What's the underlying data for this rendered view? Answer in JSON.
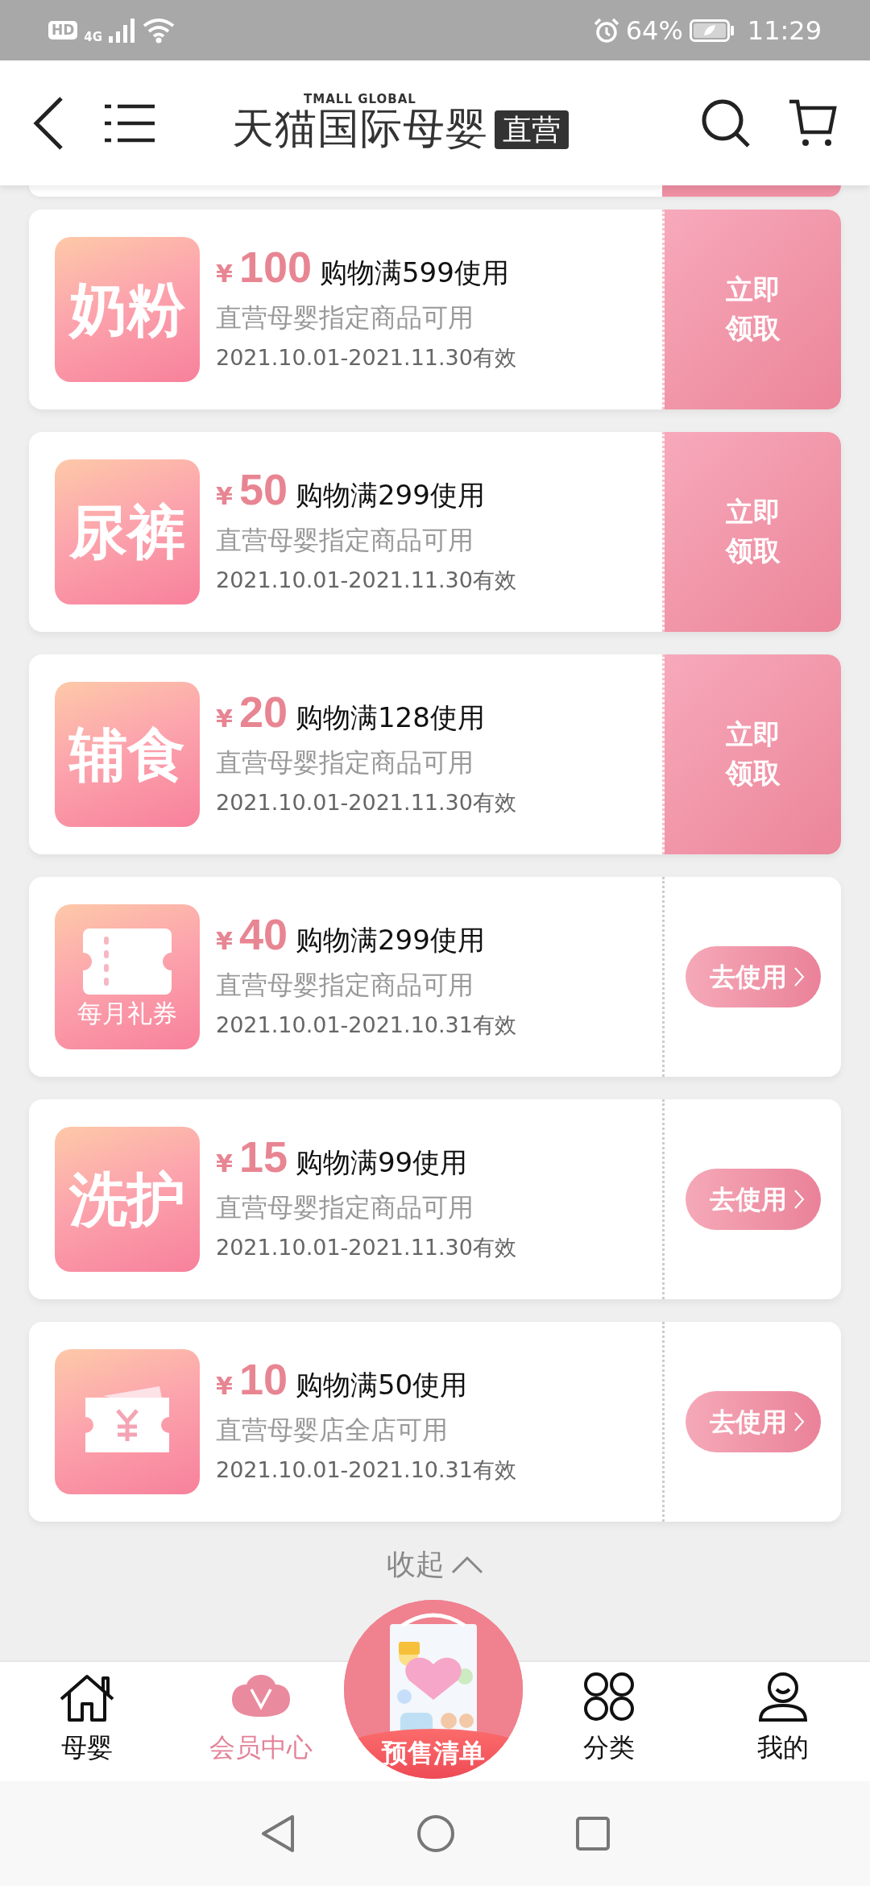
{
  "status_bar": {
    "hd": "HD",
    "network": "4G",
    "battery": "64%",
    "time": "11:29"
  },
  "header": {
    "brand_small": "TMALL GLOBAL",
    "brand": "天猫国际母婴",
    "badge": "直营"
  },
  "coupons": [
    {
      "icon": {
        "kind": "text",
        "label": "奶粉"
      },
      "currency": "¥",
      "amount": "100",
      "condition": "购物满599使用",
      "scope": "直营母婴指定商品可用",
      "validity": "2021.10.01-2021.11.30有效",
      "action": {
        "kind": "claim",
        "label": "立即领取"
      }
    },
    {
      "icon": {
        "kind": "text",
        "label": "尿裤"
      },
      "currency": "¥",
      "amount": "50",
      "condition": "购物满299使用",
      "scope": "直营母婴指定商品可用",
      "validity": "2021.10.01-2021.11.30有效",
      "action": {
        "kind": "claim",
        "label": "立即领取"
      }
    },
    {
      "icon": {
        "kind": "text",
        "label": "辅食"
      },
      "currency": "¥",
      "amount": "20",
      "condition": "购物满128使用",
      "scope": "直营母婴指定商品可用",
      "validity": "2021.10.01-2021.11.30有效",
      "action": {
        "kind": "claim",
        "label": "立即领取"
      }
    },
    {
      "icon": {
        "kind": "ticket",
        "label": "每月礼券"
      },
      "currency": "¥",
      "amount": "40",
      "condition": "购物满299使用",
      "scope": "直营母婴指定商品可用",
      "validity": "2021.10.01-2021.10.31有效",
      "action": {
        "kind": "use",
        "label": "去使用"
      }
    },
    {
      "icon": {
        "kind": "text",
        "label": "洗护"
      },
      "currency": "¥",
      "amount": "15",
      "condition": "购物满99使用",
      "scope": "直营母婴指定商品可用",
      "validity": "2021.10.01-2021.11.30有效",
      "action": {
        "kind": "use",
        "label": "去使用"
      }
    },
    {
      "icon": {
        "kind": "yen"
      },
      "currency": "¥",
      "amount": "10",
      "condition": "购物满50使用",
      "scope": "直营母婴店全店可用",
      "validity": "2021.10.01-2021.10.31有效",
      "action": {
        "kind": "use",
        "label": "去使用"
      }
    }
  ],
  "collapse": {
    "label": "收起"
  },
  "tab_bar": [
    {
      "kind": "home",
      "label": "母婴",
      "selected": false
    },
    {
      "kind": "member",
      "label": "会员中心",
      "selected": true
    },
    {
      "kind": "promo",
      "label": "预售清单",
      "selected": false
    },
    {
      "kind": "category",
      "label": "分类",
      "selected": false
    },
    {
      "kind": "profile",
      "label": "我的",
      "selected": false
    }
  ]
}
